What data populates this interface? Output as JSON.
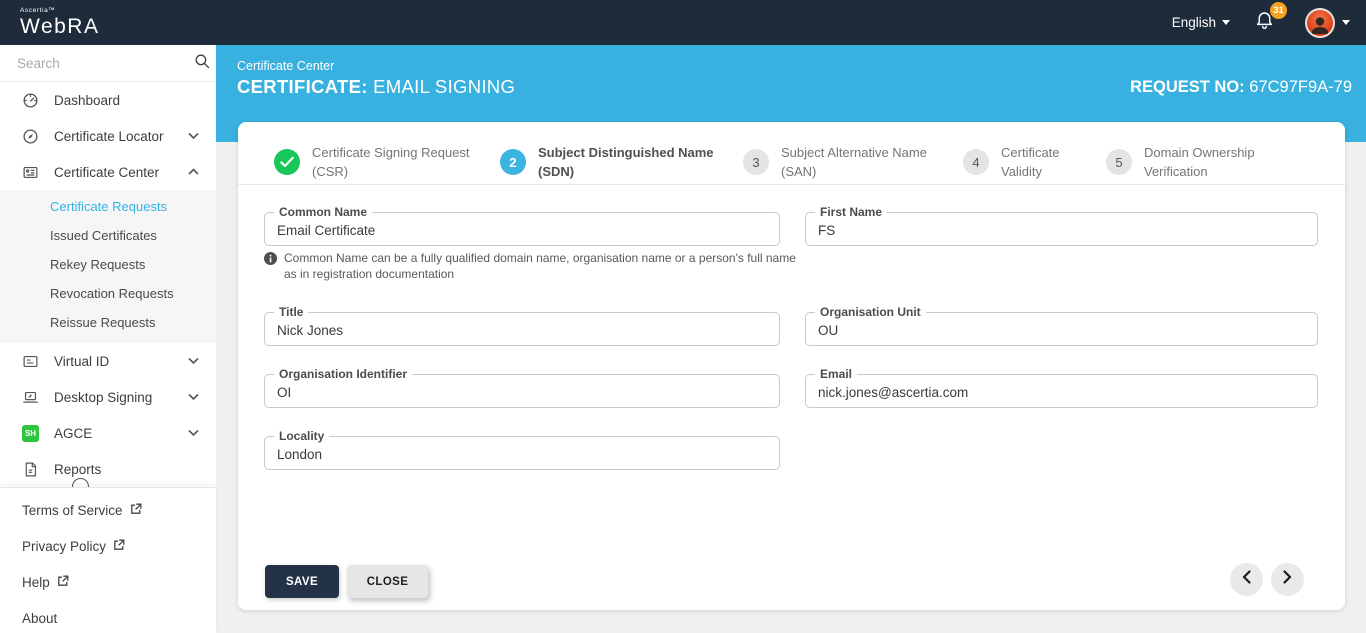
{
  "topbar": {
    "brand_small": "Ascertia™",
    "brand_name": "WebRA",
    "language": "English",
    "notification_count": "31"
  },
  "sidebar": {
    "search_placeholder": "Search",
    "items": [
      {
        "label": "Dashboard",
        "icon": "dashboard-gauge-icon"
      },
      {
        "label": "Certificate Locator",
        "icon": "compass-icon",
        "chevron": "down"
      },
      {
        "label": "Certificate Center",
        "icon": "certificate-card-icon",
        "chevron": "up",
        "expanded": true
      },
      {
        "label": "Virtual ID",
        "icon": "virtual-id-card-icon",
        "chevron": "down"
      },
      {
        "label": "Desktop Signing",
        "icon": "laptop-signing-icon",
        "chevron": "down"
      },
      {
        "label": "AGCE",
        "icon": "sh-green-square-icon",
        "chevron": "down"
      },
      {
        "label": "Reports",
        "icon": "document-icon"
      }
    ],
    "agce_badge": "SH",
    "submenu": [
      {
        "label": "Certificate Requests",
        "active": true
      },
      {
        "label": "Issued Certificates"
      },
      {
        "label": "Rekey Requests"
      },
      {
        "label": "Revocation Requests"
      },
      {
        "label": "Reissue Requests"
      }
    ],
    "footer": [
      {
        "label": "Terms of Service",
        "external": true
      },
      {
        "label": "Privacy Policy",
        "external": true
      },
      {
        "label": "Help",
        "external": true
      },
      {
        "label": "About",
        "external": false
      }
    ]
  },
  "header": {
    "breadcrumb": "Certificate Center",
    "title_prefix": "CERTIFICATE:",
    "title_value": "EMAIL SIGNING",
    "request_label": "REQUEST NO:",
    "request_value": "67C97F9A-79"
  },
  "stepper": {
    "steps": [
      {
        "number": "✓",
        "state": "done",
        "line1": "Certificate Signing Request",
        "line2": "(CSR)"
      },
      {
        "number": "2",
        "state": "active",
        "line1": "Subject Distinguished Name",
        "line2": "(SDN)"
      },
      {
        "number": "3",
        "state": "todo",
        "line1": "Subject Alternative Name",
        "line2": "(SAN)"
      },
      {
        "number": "4",
        "state": "todo",
        "line1": "Certificate",
        "line2": "Validity"
      },
      {
        "number": "5",
        "state": "todo",
        "line1": "Domain Ownership",
        "line2": "Verification"
      }
    ]
  },
  "form": {
    "fields": {
      "common_name": {
        "label": "Common Name",
        "value": "Email Certificate"
      },
      "first_name": {
        "label": "First Name",
        "value": "FS"
      },
      "title": {
        "label": "Title",
        "value": "Nick Jones"
      },
      "organisation_unit": {
        "label": "Organisation Unit",
        "value": "OU"
      },
      "organisation_identifier": {
        "label": "Organisation Identifier",
        "value": "OI"
      },
      "email": {
        "label": "Email",
        "value": "nick.jones@ascertia.com"
      },
      "locality": {
        "label": "Locality",
        "value": "London"
      }
    },
    "common_name_hint": "Common Name can be a fully qualified domain name, organisation name or a person's full name as in registration documentation"
  },
  "actions": {
    "save": "SAVE",
    "close": "CLOSE"
  },
  "colors": {
    "topbar": "#1e2b3b",
    "accent_cyan": "#38b1e0",
    "active_link": "#31b4e4",
    "success_green": "#16c75a",
    "badge_orange": "#f6a21e",
    "save_button": "#233247"
  }
}
